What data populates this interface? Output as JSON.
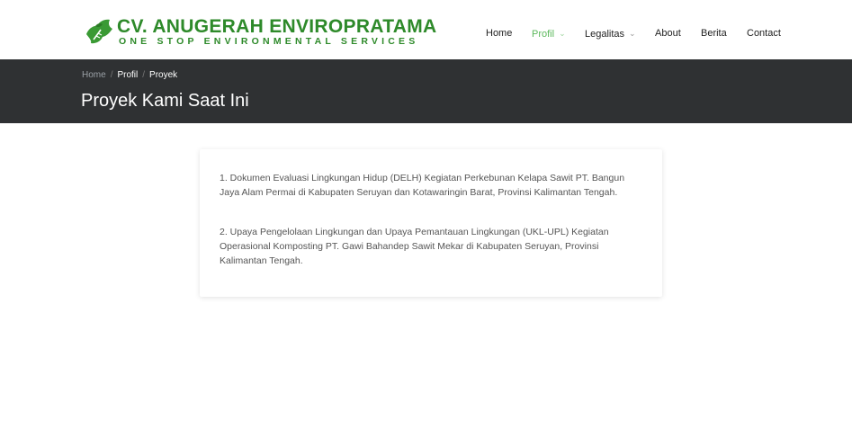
{
  "brand": {
    "name": "CV. ANUGERAH ENVIROPRATAMA",
    "tagline": "ONE STOP ENVIRONMENTAL SERVICES",
    "logo_icon": "leaf-map-icon",
    "color": "#2e8a2a"
  },
  "nav": {
    "items": [
      {
        "label": "Home",
        "active": false,
        "dropdown": false
      },
      {
        "label": "Profil",
        "active": true,
        "dropdown": true
      },
      {
        "label": "Legalitas",
        "active": false,
        "dropdown": true
      },
      {
        "label": "About",
        "active": false,
        "dropdown": false
      },
      {
        "label": "Berita",
        "active": false,
        "dropdown": false
      },
      {
        "label": "Contact",
        "active": false,
        "dropdown": false
      }
    ],
    "active_color": "#5cb85c"
  },
  "breadcrumb": {
    "home": "Home",
    "profil": "Profil",
    "current": "Proyek",
    "separator": "/"
  },
  "page": {
    "title": "Proyek Kami Saat Ini"
  },
  "projects": [
    "1. Dokumen Evaluasi Lingkungan Hidup (DELH) Kegiatan Perkebunan Kelapa Sawit PT. Bangun Jaya Alam Permai di Kabupaten Seruyan dan Kotawaringin Barat, Provinsi Kalimantan Tengah.",
    "2. Upaya Pengelolaan Lingkungan dan Upaya Pemantauan Lingkungan (UKL-UPL) Kegiatan Operasional Komposting PT. Gawi Bahandep Sawit Mekar di Kabupaten Seruyan, Provinsi Kalimantan Tengah."
  ]
}
